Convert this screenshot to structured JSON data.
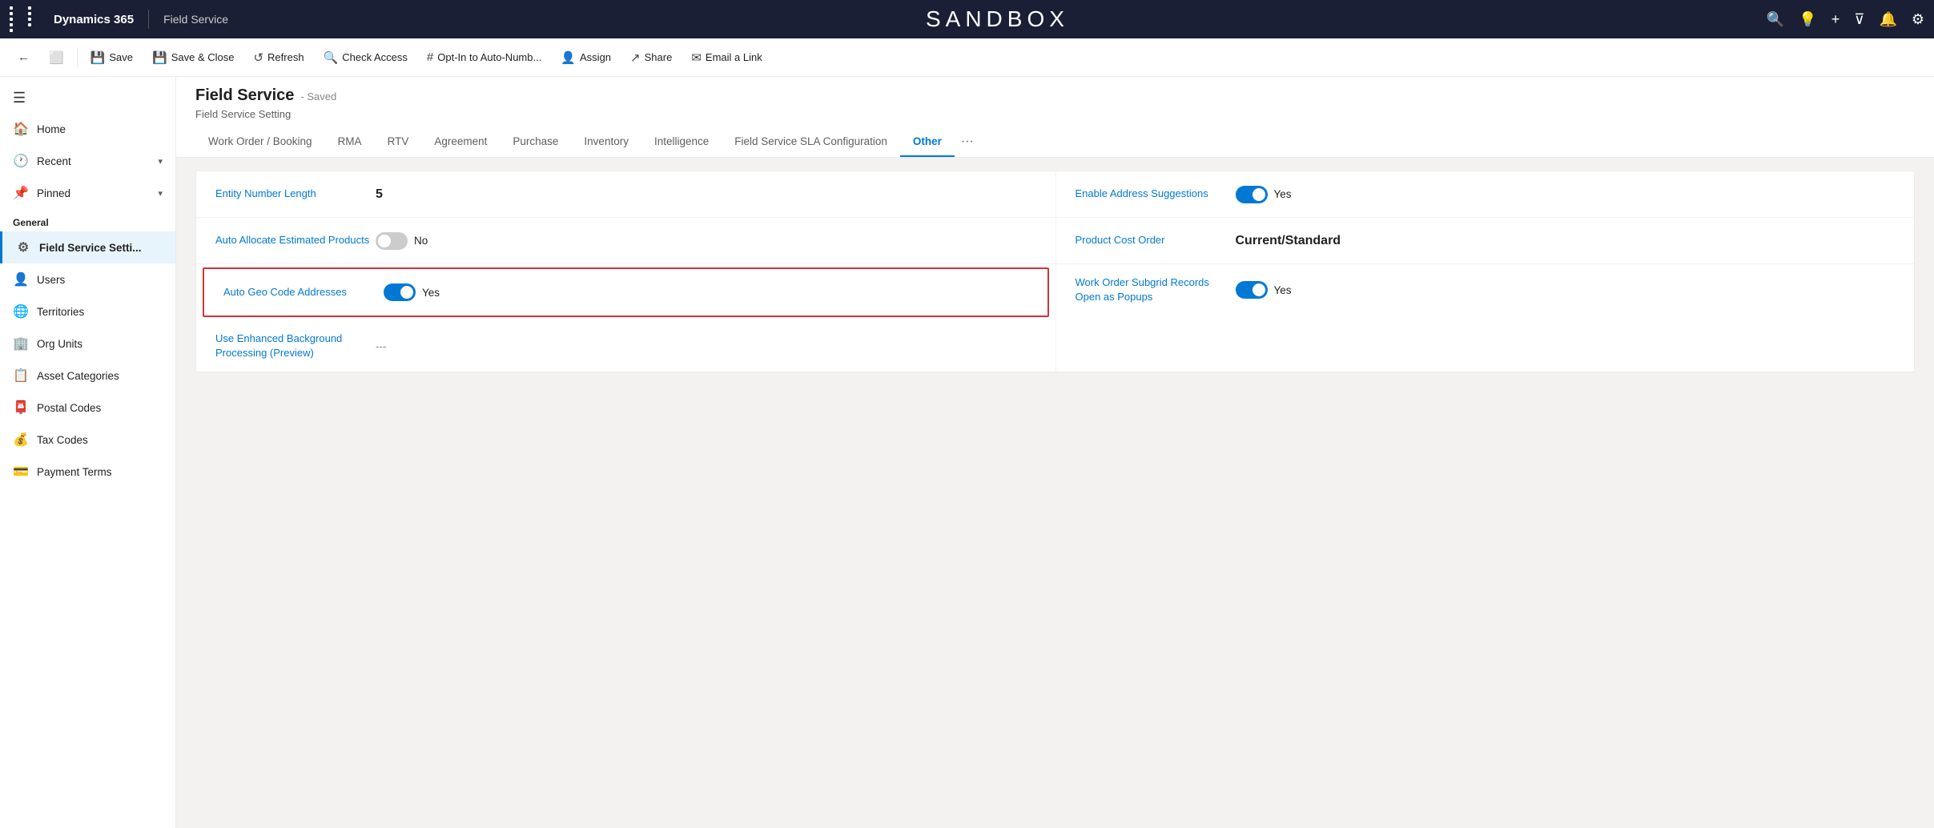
{
  "topNav": {
    "brand": "Dynamics 365",
    "appName": "Field Service",
    "sandboxTitle": "SANDBOX",
    "icons": [
      "🔍",
      "💡",
      "+",
      "▼",
      "🔔",
      "⚙"
    ]
  },
  "commandBar": {
    "buttons": [
      {
        "label": "Save",
        "icon": "💾",
        "name": "save-button"
      },
      {
        "label": "Save & Close",
        "icon": "💾",
        "name": "save-close-button"
      },
      {
        "label": "Refresh",
        "icon": "↺",
        "name": "refresh-button"
      },
      {
        "label": "Check Access",
        "icon": "🔍",
        "name": "check-access-button"
      },
      {
        "label": "Opt-In to Auto-Numb...",
        "icon": "#",
        "name": "opt-in-button"
      },
      {
        "label": "Assign",
        "icon": "👤",
        "name": "assign-button"
      },
      {
        "label": "Share",
        "icon": "↗",
        "name": "share-button"
      },
      {
        "label": "Email a Link",
        "icon": "✉",
        "name": "email-link-button"
      }
    ]
  },
  "sidebar": {
    "items": [
      {
        "label": "Home",
        "icon": "🏠",
        "name": "home"
      },
      {
        "label": "Recent",
        "icon": "🕐",
        "name": "recent",
        "chevron": "▾"
      },
      {
        "label": "Pinned",
        "icon": "📌",
        "name": "pinned",
        "chevron": "▾"
      },
      {
        "label": "General",
        "type": "section"
      },
      {
        "label": "Field Service Setti...",
        "icon": "⚙",
        "name": "field-service-settings",
        "active": true
      },
      {
        "label": "Users",
        "icon": "👤",
        "name": "users"
      },
      {
        "label": "Territories",
        "icon": "🌐",
        "name": "territories"
      },
      {
        "label": "Org Units",
        "icon": "🏢",
        "name": "org-units"
      },
      {
        "label": "Asset Categories",
        "icon": "📋",
        "name": "asset-categories"
      },
      {
        "label": "Postal Codes",
        "icon": "📮",
        "name": "postal-codes"
      },
      {
        "label": "Tax Codes",
        "icon": "💰",
        "name": "tax-codes"
      },
      {
        "label": "Payment Terms",
        "icon": "💳",
        "name": "payment-terms"
      }
    ]
  },
  "page": {
    "entity": "Field Service",
    "savedStatus": "- Saved",
    "subtitle": "Field Service Setting"
  },
  "tabs": [
    {
      "label": "Work Order / Booking",
      "name": "work-order-booking"
    },
    {
      "label": "RMA",
      "name": "rma"
    },
    {
      "label": "RTV",
      "name": "rtv"
    },
    {
      "label": "Agreement",
      "name": "agreement"
    },
    {
      "label": "Purchase",
      "name": "purchase"
    },
    {
      "label": "Inventory",
      "name": "inventory"
    },
    {
      "label": "Intelligence",
      "name": "intelligence"
    },
    {
      "label": "Field Service SLA Configuration",
      "name": "sla-config"
    },
    {
      "label": "Other",
      "name": "other",
      "active": true
    }
  ],
  "form": {
    "leftCol": [
      {
        "label": "Entity Number Length",
        "value": "5",
        "type": "text",
        "bold": true,
        "name": "entity-number-length"
      },
      {
        "label": "Auto Allocate Estimated Products",
        "value": "No",
        "toggleState": "off",
        "type": "toggle",
        "name": "auto-allocate-estimated-products"
      },
      {
        "label": "Auto Geo Code Addresses",
        "value": "Yes",
        "toggleState": "on",
        "type": "toggle",
        "name": "auto-geo-code-addresses",
        "highlighted": true
      },
      {
        "label": "Use Enhanced Background Processing (Preview)",
        "value": "---",
        "type": "text",
        "name": "use-enhanced-background-processing"
      }
    ],
    "rightCol": [
      {
        "label": "Enable Address Suggestions",
        "value": "Yes",
        "toggleState": "on",
        "type": "toggle",
        "name": "enable-address-suggestions"
      },
      {
        "label": "Product Cost Order",
        "value": "Current/Standard",
        "type": "text",
        "bold": true,
        "name": "product-cost-order"
      },
      {
        "label": "Work Order Subgrid Records Open as Popups",
        "value": "Yes",
        "toggleState": "on",
        "type": "toggle",
        "name": "work-order-subgrid-records"
      }
    ]
  }
}
